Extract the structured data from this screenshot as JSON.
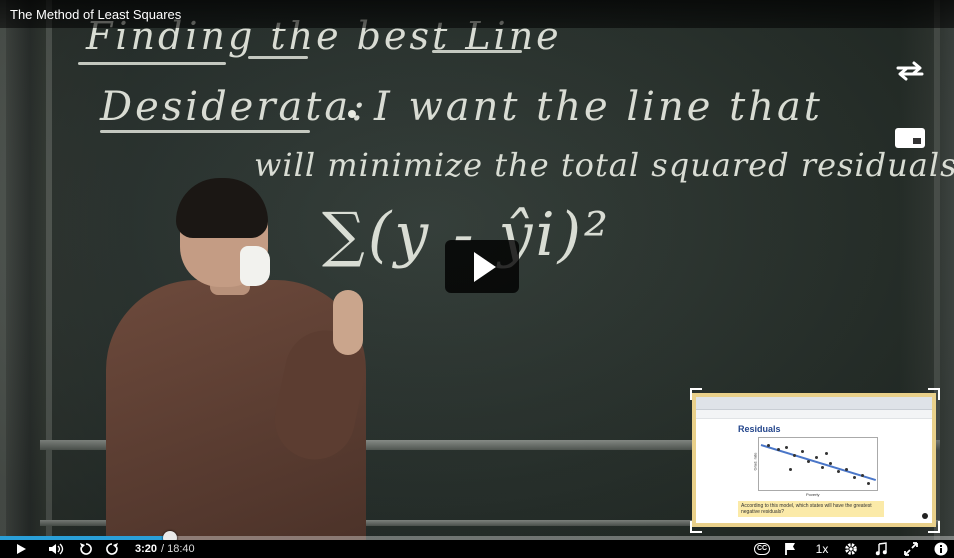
{
  "player": {
    "title": "The Method of Least Squares",
    "current_time": "3:20",
    "duration": "/ 18:40",
    "progress_fraction": 0.178,
    "speed_label": "1x",
    "cc_label": "CC",
    "accent_color": "#2a9fd8"
  },
  "board": {
    "heading": "Finding the best Line",
    "desiderata_label": "Desiderata:",
    "line1": "I want the line that",
    "line2": "will minimize the total squared residuals.",
    "formula": "∑(y - ŷi)²"
  },
  "pip_slide": {
    "title": "Residuals",
    "xlabel": "Poverty",
    "ylabel": "Grad. rate",
    "question": "According to this model, which states will have the greatest negative residuals?"
  },
  "icons": {
    "play": "play-icon",
    "volume": "volume-icon",
    "rewind": "rewind-10-icon",
    "forward": "forward-10-icon",
    "flag": "flag-icon",
    "settings": "gear-icon",
    "music": "music-note-icon",
    "fullscreen": "fullscreen-icon",
    "info": "info-icon",
    "swap": "swap-arrows-icon",
    "pip": "picture-in-picture-icon"
  }
}
